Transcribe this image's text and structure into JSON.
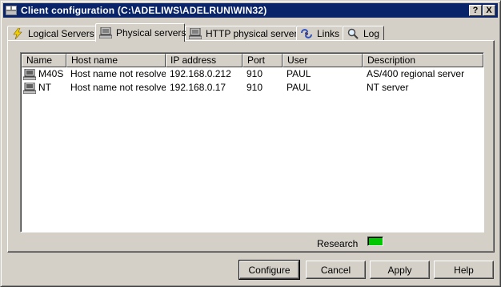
{
  "window": {
    "title": "Client configuration (C:\\ADELIWS\\ADELRUN\\WIN32)",
    "help_button": "?",
    "close_button": "X"
  },
  "tabs": [
    {
      "label": "Logical Servers",
      "icon": "lightning-icon",
      "active": false
    },
    {
      "label": "Physical servers",
      "icon": "computer-icon",
      "active": true
    },
    {
      "label": "HTTP physical servers",
      "icon": "computer-icon",
      "active": false
    },
    {
      "label": "Links",
      "icon": "links-icon",
      "active": false
    },
    {
      "label": "Log",
      "icon": "magnifier-icon",
      "active": false
    }
  ],
  "table": {
    "columns": [
      "Name",
      "Host name",
      "IP address",
      "Port",
      "User",
      "Description"
    ],
    "rows": [
      {
        "name": "M40S",
        "host": "Host name not resolved",
        "ip": "192.168.0.212",
        "port": "910",
        "user": "PAUL",
        "description": "AS/400 regional server"
      },
      {
        "name": "NT",
        "host": "Host name not resolved",
        "ip": "192.168.0.17",
        "port": "910",
        "user": "PAUL",
        "description": "NT server"
      }
    ]
  },
  "research": {
    "label": "Research",
    "indicator_color": "#00c800"
  },
  "buttons": {
    "configure": "Configure",
    "cancel": "Cancel",
    "apply": "Apply",
    "help": "Help"
  },
  "colors": {
    "title_bar": "#0a246a",
    "face": "#d4d0c8"
  }
}
